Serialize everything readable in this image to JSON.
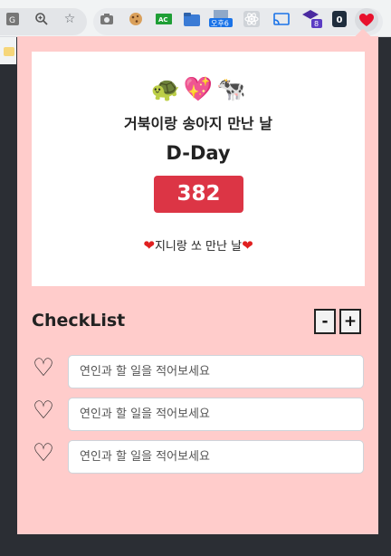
{
  "browser": {
    "toolbar_icons": [
      "translate-icon",
      "zoom-icon",
      "star-icon",
      "camera-icon",
      "cookie-icon",
      "ac-extension-icon",
      "folder-extension-icon",
      "clock-extension-icon",
      "react-icon",
      "cast-icon",
      "grad-cap-extension-icon",
      "onepass-icon",
      "heart-extension-icon"
    ],
    "ac_label": "AC",
    "clock_label": "오후6",
    "badge_count": "8",
    "onepass_label": "0"
  },
  "card": {
    "emojis": [
      "🐢",
      "💖",
      "🐄"
    ],
    "title": "거북이랑 송아지 만난 날",
    "dday_label": "D-Day",
    "dday_count": "382",
    "subtitle_heart_left": "❤",
    "subtitle": "지니랑 쏘 만난 날",
    "subtitle_heart_right": "❤"
  },
  "checklist": {
    "title": "CheckList",
    "minus_label": "-",
    "plus_label": "+",
    "items": [
      {
        "value": "",
        "placeholder": "연인과 할 일을 적어보세요"
      },
      {
        "value": "",
        "placeholder": "연인과 할 일을 적어보세요"
      },
      {
        "value": "",
        "placeholder": "연인과 할 일을 적어보세요"
      }
    ]
  },
  "colors": {
    "popup_bg": "#ffcccb",
    "accent": "#dc3545"
  }
}
